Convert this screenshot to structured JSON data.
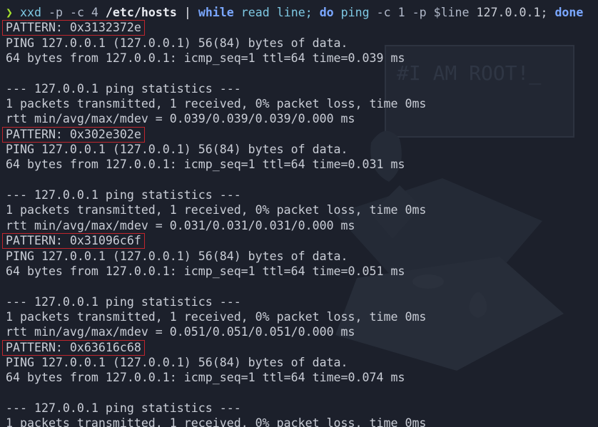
{
  "terminal": {
    "prompt_symbol": "❯",
    "command": {
      "tool": "xxd",
      "tool_args": "-p -c 4",
      "file": "/etc/hosts",
      "pipe": "|",
      "kw_while": "while",
      "read_cmd": "read line;",
      "kw_do": "do",
      "ping_cmd": "ping",
      "ping_args": "-c 1 -p",
      "var": "$line",
      "target": "127.0.0.1;",
      "kw_done": "done"
    },
    "blocks": [
      {
        "pattern": "PATTERN: 0x3132372e",
        "ping_header": "PING 127.0.0.1 (127.0.0.1) 56(84) bytes of data.",
        "reply": "64 bytes from 127.0.0.1: icmp_seq=1 ttl=64 time=0.039 ms",
        "stats_header": "--- 127.0.0.1 ping statistics ---",
        "stats_summary": "1 packets transmitted, 1 received, 0% packet loss, time 0ms",
        "rtt": "rtt min/avg/max/mdev = 0.039/0.039/0.039/0.000 ms"
      },
      {
        "pattern": "PATTERN: 0x302e302e",
        "ping_header": "PING 127.0.0.1 (127.0.0.1) 56(84) bytes of data.",
        "reply": "64 bytes from 127.0.0.1: icmp_seq=1 ttl=64 time=0.031 ms",
        "stats_header": "--- 127.0.0.1 ping statistics ---",
        "stats_summary": "1 packets transmitted, 1 received, 0% packet loss, time 0ms",
        "rtt": "rtt min/avg/max/mdev = 0.031/0.031/0.031/0.000 ms"
      },
      {
        "pattern": "PATTERN: 0x31096c6f",
        "ping_header": "PING 127.0.0.1 (127.0.0.1) 56(84) bytes of data.",
        "reply": "64 bytes from 127.0.0.1: icmp_seq=1 ttl=64 time=0.051 ms",
        "stats_header": "--- 127.0.0.1 ping statistics ---",
        "stats_summary": "1 packets transmitted, 1 received, 0% packet loss, time 0ms",
        "rtt": "rtt min/avg/max/mdev = 0.051/0.051/0.051/0.000 ms"
      },
      {
        "pattern": "PATTERN: 0x63616c68",
        "ping_header": "PING 127.0.0.1 (127.0.0.1) 56(84) bytes of data.",
        "reply": "64 bytes from 127.0.0.1: icmp_seq=1 ttl=64 time=0.074 ms",
        "stats_header": "--- 127.0.0.1 ping statistics ---",
        "stats_summary": "1 packets transmitted, 1 received, 0% packet loss, time 0ms"
      }
    ],
    "wallpaper_text": "#I AM ROOT!_",
    "colors": {
      "background": "#1c202b",
      "text": "#c9cdd6",
      "prompt": "#a6e22e",
      "keyword": "#7aa7ff",
      "command": "#7ec8e3",
      "highlight_box": "#c0262d"
    }
  }
}
